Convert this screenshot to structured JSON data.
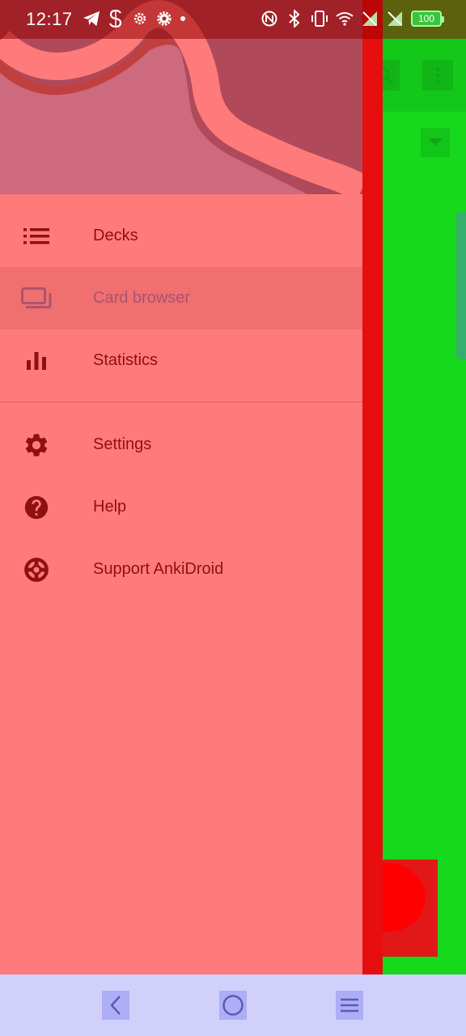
{
  "status_bar": {
    "time": "12:17",
    "battery": "100",
    "left_icons": [
      "telegram-icon",
      "s-app-icon",
      "settings-gear-icon",
      "settings-gear-icon",
      "dot-icon"
    ],
    "right_icons": [
      "nfc-icon",
      "bluetooth-icon",
      "vibrate-icon",
      "wifi-icon",
      "no-sim-icon",
      "no-sim-icon",
      "battery-icon"
    ]
  },
  "drawer": {
    "items": [
      {
        "label": "Decks",
        "icon": "list-icon",
        "selected": false
      },
      {
        "label": "Card browser",
        "icon": "cards-icon",
        "selected": true
      },
      {
        "label": "Statistics",
        "icon": "bar-chart-icon",
        "selected": false
      },
      {
        "label": "Settings",
        "icon": "gear-icon",
        "selected": false
      },
      {
        "label": "Help",
        "icon": "help-icon",
        "selected": false
      },
      {
        "label": "Support AnkiDroid",
        "icon": "lifebuoy-icon",
        "selected": false
      }
    ]
  },
  "background_app": {
    "toolbar_icons": [
      "search-icon",
      "more-vert-icon"
    ],
    "dropdown_icon": "dropdown-arrow-icon",
    "fab_icon": "add-icon"
  },
  "nav_bar": {
    "buttons": [
      "back-icon",
      "home-icon",
      "recents-icon"
    ]
  },
  "colors": {
    "drawer_bg": "#ff7b7b",
    "header_bg": "#c84848",
    "menu_text": "#8f1010",
    "selected_text": "#a85472",
    "app_bg": "#16d81c",
    "nav_bar_bg": "#d0d0fb"
  }
}
